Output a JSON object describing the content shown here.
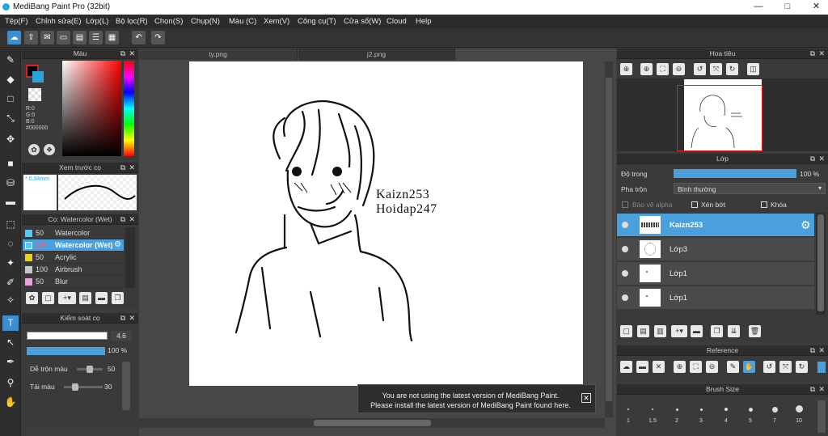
{
  "window": {
    "title": "MediBang Paint Pro (32bit)",
    "minimize": "—",
    "maximize": "□",
    "close": "✕"
  },
  "menu": [
    "Tệp(F)",
    "Chỉnh sửa(E)",
    "Lớp(L)",
    "Bộ lọc(R)",
    "Chọn(S)",
    "Chụp(N)",
    "Màu (C)",
    "Xem(V)",
    "Công cụ(T)",
    "Cửa sổ(W)",
    "Cloud",
    "Help"
  ],
  "color_panel": {
    "title": "Màu",
    "r": "R:0",
    "g": "G:0",
    "b": "B:0",
    "hex": "#000000"
  },
  "preview_panel": {
    "title": "Xem trước cọ",
    "size": "0.34mm"
  },
  "brush_panel": {
    "title": "Cọ: Watercolor (Wet)",
    "items": [
      {
        "size": "50",
        "name": "Watercolor",
        "color": "#5ac8f0"
      },
      {
        "size": "4.6",
        "name": "Watercolor (Wet)",
        "color": "#5ac8f0"
      },
      {
        "size": "50",
        "name": "Acrylic",
        "color": "#e8d020"
      },
      {
        "size": "100",
        "name": "Airbrush",
        "color": "#c8c8c8"
      },
      {
        "size": "50",
        "name": "Blur",
        "color": "#f0a0e0"
      }
    ]
  },
  "control_panel": {
    "title": "Kiểm soát cọ",
    "size_value": "4.6",
    "opacity_value": "100 %",
    "mix_label": "Dễ trộn màu",
    "mix_value": "50",
    "load_label": "Tải màu",
    "load_value": "30"
  },
  "tabs": [
    "ty.png",
    "j2.png"
  ],
  "canvas": {
    "text_line1": "Kaizn253",
    "text_line2": "Hoidap247"
  },
  "notice": {
    "line1": "You are not using the latest version of MediBang Paint.",
    "line2": "Please install the latest version of MediBang Paint found here.",
    "close": "✕"
  },
  "navigator": {
    "title": "Hoa tiêu"
  },
  "layer_panel": {
    "title": "Lớp",
    "opacity_label": "Độ trong",
    "opacity_value": "100 %",
    "opacity_fraction": 1.0,
    "blend_label": "Pha trộn",
    "blend_value": "Bình thường",
    "protect_alpha": "Bảo vệ alpha",
    "clipping": "Xén bớt",
    "lock": "Khóa",
    "layers": [
      "Kaizn253",
      "Lớp3",
      "Lớp1",
      "Lớp1"
    ]
  },
  "reference_panel": {
    "title": "Reference"
  },
  "brush_size_panel": {
    "title": "Brush Size",
    "sizes": [
      "1",
      "1.5",
      "2",
      "3",
      "4",
      "5",
      "7",
      "10"
    ]
  }
}
